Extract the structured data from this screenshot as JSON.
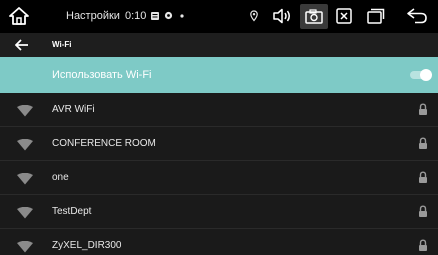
{
  "status_bar": {
    "title": "Настройки",
    "time": "0:10",
    "icons": {
      "home": "home-icon",
      "notification": "message-icon",
      "media": "media-dot-icon",
      "location": "location-icon",
      "volume": "volume-icon",
      "screenshot": "screenshot-icon",
      "close": "close-box-icon",
      "windows": "recent-apps-icon",
      "back": "back-icon"
    }
  },
  "header": {
    "title": "Wi-Fi",
    "back_icon": "arrow-left-icon"
  },
  "master": {
    "label": "Использовать Wi-Fi",
    "enabled": true,
    "accent": "#7ecac6"
  },
  "networks": [
    {
      "ssid": "AVR WiFi",
      "secured": true
    },
    {
      "ssid": "CONFERENCE ROOM",
      "secured": true
    },
    {
      "ssid": "one",
      "secured": true
    },
    {
      "ssid": "TestDept",
      "secured": true
    },
    {
      "ssid": "ZyXEL_DIR300",
      "secured": true
    }
  ]
}
